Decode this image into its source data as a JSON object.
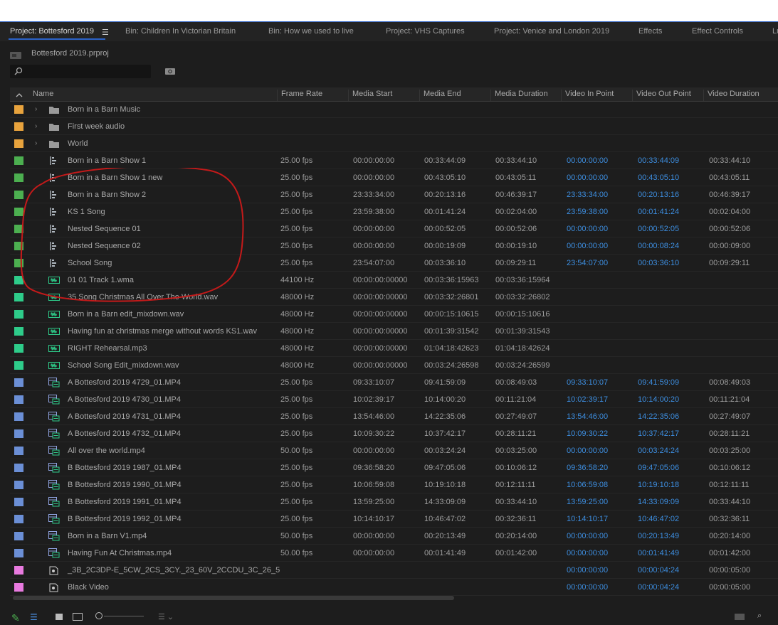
{
  "tabs": [
    {
      "label": "Project: Bottesford 2019",
      "active": true
    },
    {
      "label": "Bin: Children In Victorian Britain"
    },
    {
      "label": "Bin: How we used to live"
    },
    {
      "label": "Project: VHS Captures"
    },
    {
      "label": "Project: Venice and London 2019"
    },
    {
      "label": "Effects"
    },
    {
      "label": "Effect Controls"
    },
    {
      "label": "Lu"
    }
  ],
  "project_file": "Bottesford 2019.prproj",
  "search": {
    "value": "",
    "placeholder": ""
  },
  "columns": [
    "Name",
    "Frame Rate",
    "Media Start",
    "Media End",
    "Media Duration",
    "Video In Point",
    "Video Out Point",
    "Video Duration"
  ],
  "colors": {
    "orange": "#e8a33d",
    "green": "#4caf50",
    "teal": "#2ecc8a",
    "blue": "#6b8fd6",
    "pink": "#e87adf",
    "accent_blue": "#3d8ee0",
    "annotation_red": "#c41a1a"
  },
  "rows": [
    {
      "type": "folder",
      "label": "orange",
      "name": "Born in a Barn Music",
      "fps": "",
      "ms": "",
      "me": "",
      "md": "",
      "vi": "",
      "vo": "",
      "vd": ""
    },
    {
      "type": "folder",
      "label": "orange",
      "name": "First week audio",
      "fps": "",
      "ms": "",
      "me": "",
      "md": "",
      "vi": "",
      "vo": "",
      "vd": ""
    },
    {
      "type": "folder",
      "label": "orange",
      "name": "World",
      "fps": "",
      "ms": "",
      "me": "",
      "md": "",
      "vi": "",
      "vo": "",
      "vd": ""
    },
    {
      "type": "sequence",
      "label": "green",
      "name": "Born in a Barn Show 1",
      "fps": "25.00 fps",
      "ms": "00:00:00:00",
      "me": "00:33:44:09",
      "md": "00:33:44:10",
      "vi": "00:00:00:00",
      "vo": "00:33:44:09",
      "vd": "00:33:44:10"
    },
    {
      "type": "sequence",
      "label": "green",
      "name": "Born in a Barn Show 1 new",
      "fps": "25.00 fps",
      "ms": "00:00:00:00",
      "me": "00:43:05:10",
      "md": "00:43:05:11",
      "vi": "00:00:00:00",
      "vo": "00:43:05:10",
      "vd": "00:43:05:11"
    },
    {
      "type": "sequence",
      "label": "green",
      "name": "Born in a Barn Show 2",
      "fps": "25.00 fps",
      "ms": "23:33:34:00",
      "me": "00:20:13:16",
      "md": "00:46:39:17",
      "vi": "23:33:34:00",
      "vo": "00:20:13:16",
      "vd": "00:46:39:17"
    },
    {
      "type": "sequence",
      "label": "green",
      "name": "KS 1 Song",
      "fps": "25.00 fps",
      "ms": "23:59:38:00",
      "me": "00:01:41:24",
      "md": "00:02:04:00",
      "vi": "23:59:38:00",
      "vo": "00:01:41:24",
      "vd": "00:02:04:00"
    },
    {
      "type": "sequence",
      "label": "green",
      "name": "Nested Sequence 01",
      "fps": "25.00 fps",
      "ms": "00:00:00:00",
      "me": "00:00:52:05",
      "md": "00:00:52:06",
      "vi": "00:00:00:00",
      "vo": "00:00:52:05",
      "vd": "00:00:52:06"
    },
    {
      "type": "sequence",
      "label": "green",
      "name": "Nested Sequence 02",
      "fps": "25.00 fps",
      "ms": "00:00:00:00",
      "me": "00:00:19:09",
      "md": "00:00:19:10",
      "vi": "00:00:00:00",
      "vo": "00:00:08:24",
      "vd": "00:00:09:00"
    },
    {
      "type": "sequence",
      "label": "green",
      "name": "School Song",
      "fps": "25.00 fps",
      "ms": "23:54:07:00",
      "me": "00:03:36:10",
      "md": "00:09:29:11",
      "vi": "23:54:07:00",
      "vo": "00:03:36:10",
      "vd": "00:09:29:11"
    },
    {
      "type": "audio",
      "label": "teal",
      "name": "01 01 Track 1.wma",
      "fps": "44100 Hz",
      "ms": "00:00:00:00000",
      "me": "00:03:36:15963",
      "md": "00:03:36:15964",
      "vi": "",
      "vo": "",
      "vd": ""
    },
    {
      "type": "audio",
      "label": "teal",
      "name": "35 Song Christmas All Over The World.wav",
      "fps": "48000 Hz",
      "ms": "00:00:00:00000",
      "me": "00:03:32:26801",
      "md": "00:03:32:26802",
      "vi": "",
      "vo": "",
      "vd": ""
    },
    {
      "type": "audio",
      "label": "teal",
      "name": "Born in a Barn edit_mixdown.wav",
      "fps": "48000 Hz",
      "ms": "00:00:00:00000",
      "me": "00:00:15:10615",
      "md": "00:00:15:10616",
      "vi": "",
      "vo": "",
      "vd": ""
    },
    {
      "type": "audio",
      "label": "teal",
      "name": "Having fun at christmas merge without words KS1.wav",
      "fps": "48000 Hz",
      "ms": "00:00:00:00000",
      "me": "00:01:39:31542",
      "md": "00:01:39:31543",
      "vi": "",
      "vo": "",
      "vd": ""
    },
    {
      "type": "audio",
      "label": "teal",
      "name": "RIGHT Rehearsal.mp3",
      "fps": "48000 Hz",
      "ms": "00:00:00:00000",
      "me": "01:04:18:42623",
      "md": "01:04:18:42624",
      "vi": "",
      "vo": "",
      "vd": ""
    },
    {
      "type": "audio",
      "label": "teal",
      "name": "School Song Edit_mixdown.wav",
      "fps": "48000 Hz",
      "ms": "00:00:00:00000",
      "me": "00:03:24:26598",
      "md": "00:03:24:26599",
      "vi": "",
      "vo": "",
      "vd": ""
    },
    {
      "type": "video",
      "label": "blue",
      "name": "A Bottesford 2019 4729_01.MP4",
      "fps": "25.00 fps",
      "ms": "09:33:10:07",
      "me": "09:41:59:09",
      "md": "00:08:49:03",
      "vi": "09:33:10:07",
      "vo": "09:41:59:09",
      "vd": "00:08:49:03"
    },
    {
      "type": "video",
      "label": "blue",
      "name": "A Bottesford 2019 4730_01.MP4",
      "fps": "25.00 fps",
      "ms": "10:02:39:17",
      "me": "10:14:00:20",
      "md": "00:11:21:04",
      "vi": "10:02:39:17",
      "vo": "10:14:00:20",
      "vd": "00:11:21:04"
    },
    {
      "type": "video",
      "label": "blue",
      "name": "A Bottesford 2019 4731_01.MP4",
      "fps": "25.00 fps",
      "ms": "13:54:46:00",
      "me": "14:22:35:06",
      "md": "00:27:49:07",
      "vi": "13:54:46:00",
      "vo": "14:22:35:06",
      "vd": "00:27:49:07"
    },
    {
      "type": "video",
      "label": "blue",
      "name": "A Bottesford 2019 4732_01.MP4",
      "fps": "25.00 fps",
      "ms": "10:09:30:22",
      "me": "10:37:42:17",
      "md": "00:28:11:21",
      "vi": "10:09:30:22",
      "vo": "10:37:42:17",
      "vd": "00:28:11:21"
    },
    {
      "type": "video",
      "label": "blue",
      "name": "All over the world.mp4",
      "fps": "50.00 fps",
      "ms": "00:00:00:00",
      "me": "00:03:24:24",
      "md": "00:03:25:00",
      "vi": "00:00:00:00",
      "vo": "00:03:24:24",
      "vd": "00:03:25:00"
    },
    {
      "type": "video",
      "label": "blue",
      "name": "B Bottesford 2019 1987_01.MP4",
      "fps": "25.00 fps",
      "ms": "09:36:58:20",
      "me": "09:47:05:06",
      "md": "00:10:06:12",
      "vi": "09:36:58:20",
      "vo": "09:47:05:06",
      "vd": "00:10:06:12"
    },
    {
      "type": "video",
      "label": "blue",
      "name": "B Bottesford 2019 1990_01.MP4",
      "fps": "25.00 fps",
      "ms": "10:06:59:08",
      "me": "10:19:10:18",
      "md": "00:12:11:11",
      "vi": "10:06:59:08",
      "vo": "10:19:10:18",
      "vd": "00:12:11:11"
    },
    {
      "type": "video",
      "label": "blue",
      "name": "B Bottesford 2019 1991_01.MP4",
      "fps": "25.00 fps",
      "ms": "13:59:25:00",
      "me": "14:33:09:09",
      "md": "00:33:44:10",
      "vi": "13:59:25:00",
      "vo": "14:33:09:09",
      "vd": "00:33:44:10"
    },
    {
      "type": "video",
      "label": "blue",
      "name": "B Bottesford 2019 1992_01.MP4",
      "fps": "25.00 fps",
      "ms": "10:14:10:17",
      "me": "10:46:47:02",
      "md": "00:32:36:11",
      "vi": "10:14:10:17",
      "vo": "10:46:47:02",
      "vd": "00:32:36:11"
    },
    {
      "type": "video",
      "label": "blue",
      "name": "Born in a Barn V1.mp4",
      "fps": "50.00 fps",
      "ms": "00:00:00:00",
      "me": "00:20:13:49",
      "md": "00:20:14:00",
      "vi": "00:00:00:00",
      "vo": "00:20:13:49",
      "vd": "00:20:14:00"
    },
    {
      "type": "video",
      "label": "blue",
      "name": "Having Fun At Christmas.mp4",
      "fps": "50.00 fps",
      "ms": "00:00:00:00",
      "me": "00:01:41:49",
      "md": "00:01:42:00",
      "vi": "00:00:00:00",
      "vo": "00:01:41:49",
      "vd": "00:01:42:00"
    },
    {
      "type": "still",
      "label": "pink",
      "name": "_3B_2C3DP-E_5CW_2CS_3CY._23_60V_2CCDU_3C_26_5",
      "fps": "",
      "ms": "",
      "me": "",
      "md": "",
      "vi": "00:00:00:00",
      "vo": "00:00:04:24",
      "vd": "00:00:05:00"
    },
    {
      "type": "still",
      "label": "pink",
      "name": "Black Video",
      "fps": "",
      "ms": "",
      "me": "",
      "md": "",
      "vi": "00:00:00:00",
      "vo": "00:00:04:24",
      "vd": "00:00:05:00"
    }
  ]
}
